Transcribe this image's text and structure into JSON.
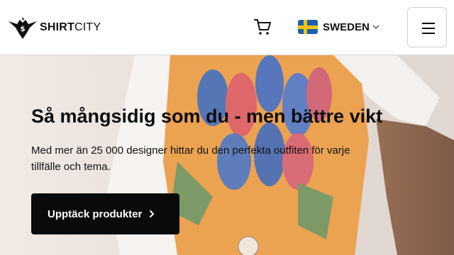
{
  "header": {
    "logo": {
      "bold": "SHIRT",
      "regular": "CITY"
    },
    "cart_icon": "cart-icon",
    "country": {
      "label": "SWEDEN",
      "flag": "sweden-flag-icon"
    },
    "menu_icon": "hamburger-menu-icon"
  },
  "hero": {
    "title": "Så mångsidig som du - men bättre vikt",
    "description": "Med mer än 25 000 designer hittar du den perfekta outfiten för varje tillfälle och tema.",
    "cta_label": "Upptäck produkter",
    "cta_icon": "chevron-right-icon"
  },
  "colors": {
    "primary_button": "#0a0a0a",
    "flag_blue": "#1c5fb3",
    "flag_yellow": "#f3c500",
    "shirt_orange": "#e9963a"
  }
}
